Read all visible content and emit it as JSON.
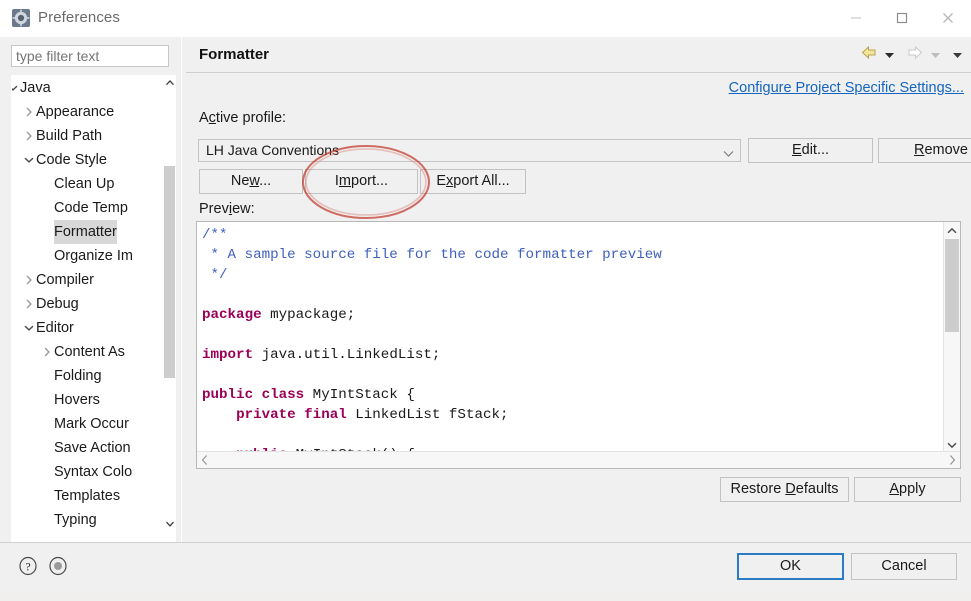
{
  "window": {
    "title": "Preferences",
    "icon": "preferences-gear-icon",
    "minimize_label": "Minimize",
    "maximize_label": "Maximize",
    "close_label": "Close"
  },
  "sidebar": {
    "filter": {
      "value": "",
      "placeholder": "type filter text"
    },
    "items": [
      {
        "label": "Java",
        "indent": 0,
        "twisty": "down",
        "selected": false
      },
      {
        "label": "Appearance",
        "indent": 1,
        "twisty": "right",
        "selected": false
      },
      {
        "label": "Build Path",
        "indent": 1,
        "twisty": "right",
        "selected": false
      },
      {
        "label": "Code Style",
        "indent": 1,
        "twisty": "down",
        "selected": false
      },
      {
        "label": "Clean Up",
        "indent": 2,
        "twisty": "none",
        "selected": false
      },
      {
        "label": "Code Temp",
        "indent": 2,
        "twisty": "none",
        "selected": false
      },
      {
        "label": "Formatter",
        "indent": 2,
        "twisty": "none",
        "selected": true
      },
      {
        "label": "Organize Im",
        "indent": 2,
        "twisty": "none",
        "selected": false
      },
      {
        "label": "Compiler",
        "indent": 1,
        "twisty": "right",
        "selected": false
      },
      {
        "label": "Debug",
        "indent": 1,
        "twisty": "right",
        "selected": false
      },
      {
        "label": "Editor",
        "indent": 1,
        "twisty": "down",
        "selected": false
      },
      {
        "label": "Content As",
        "indent": 2,
        "twisty": "right",
        "selected": false
      },
      {
        "label": "Folding",
        "indent": 2,
        "twisty": "none",
        "selected": false
      },
      {
        "label": "Hovers",
        "indent": 2,
        "twisty": "none",
        "selected": false
      },
      {
        "label": "Mark Occur",
        "indent": 2,
        "twisty": "none",
        "selected": false
      },
      {
        "label": "Save Action",
        "indent": 2,
        "twisty": "none",
        "selected": false
      },
      {
        "label": "Syntax Colo",
        "indent": 2,
        "twisty": "none",
        "selected": false
      },
      {
        "label": "Templates",
        "indent": 2,
        "twisty": "none",
        "selected": false
      },
      {
        "label": "Typing",
        "indent": 2,
        "twisty": "none",
        "selected": false
      }
    ]
  },
  "page": {
    "title": "Formatter",
    "nav": {
      "back_icon": "back-arrow-icon",
      "back_menu_icon": "chevron-down-icon",
      "forward_icon": "forward-arrow-icon",
      "forward_menu_icon": "chevron-down-icon",
      "view_menu_icon": "chevron-down-icon"
    },
    "project_link": "Configure Project Specific Settings...",
    "active_profile_label_pre": "A",
    "active_profile_label_acc": "c",
    "active_profile_label_post": "tive profile:",
    "profile_combo": {
      "value": "LH Java Conventions",
      "chevron_icon": "chevron-down-icon"
    },
    "buttons": {
      "edit": {
        "pre": "",
        "acc": "E",
        "post": "dit..."
      },
      "remove": {
        "pre": "",
        "acc": "R",
        "post": "emove"
      },
      "new": {
        "pre": "Ne",
        "acc": "w",
        "post": "..."
      },
      "import": {
        "pre": "I",
        "acc": "m",
        "post": "port..."
      },
      "export": {
        "pre": "E",
        "acc": "x",
        "post": "port All..."
      },
      "restore": {
        "pre": "Restore ",
        "acc": "D",
        "post": "efaults"
      },
      "apply": {
        "pre": "",
        "acc": "A",
        "post": "pply"
      }
    },
    "preview_label_pre": "Prev",
    "preview_label_acc": "i",
    "preview_label_post": "ew:",
    "code_lines": [
      [
        {
          "t": "/**",
          "c": "com"
        }
      ],
      [
        {
          "t": " * A sample source file for the code formatter preview",
          "c": "com"
        }
      ],
      [
        {
          "t": " */",
          "c": "com"
        }
      ],
      [
        {
          "t": "",
          "c": "pl"
        }
      ],
      [
        {
          "t": "package",
          "c": "kw"
        },
        {
          "t": " mypackage;",
          "c": "pl"
        }
      ],
      [
        {
          "t": "",
          "c": "pl"
        }
      ],
      [
        {
          "t": "import",
          "c": "kw"
        },
        {
          "t": " java.util.LinkedList;",
          "c": "pl"
        }
      ],
      [
        {
          "t": "",
          "c": "pl"
        }
      ],
      [
        {
          "t": "public class",
          "c": "kw"
        },
        {
          "t": " MyIntStack {",
          "c": "pl"
        }
      ],
      [
        {
          "t": "    ",
          "c": "pl"
        },
        {
          "t": "private final",
          "c": "kw"
        },
        {
          "t": " LinkedList fStack;",
          "c": "pl"
        }
      ],
      [
        {
          "t": "",
          "c": "pl"
        }
      ],
      [
        {
          "t": "    ",
          "c": "pl"
        },
        {
          "t": "public",
          "c": "kw"
        },
        {
          "t": " MyIntStack() {",
          "c": "pl"
        }
      ]
    ]
  },
  "footer": {
    "help_icon": "help-question-icon",
    "mode_icon": "record-dot-icon",
    "ok_label": "OK",
    "cancel_label": "Cancel"
  },
  "annotation": {
    "shape": "ellipse",
    "color": "#c0392b",
    "target": "import-button"
  },
  "colors": {
    "accent_link": "#1565c0",
    "ok_focus_border": "#2b7cc4",
    "selection": "#d8d8d8",
    "comment": "#3f5fbf",
    "keyword": "#9b0057",
    "annotation_red": "#c0392b"
  }
}
